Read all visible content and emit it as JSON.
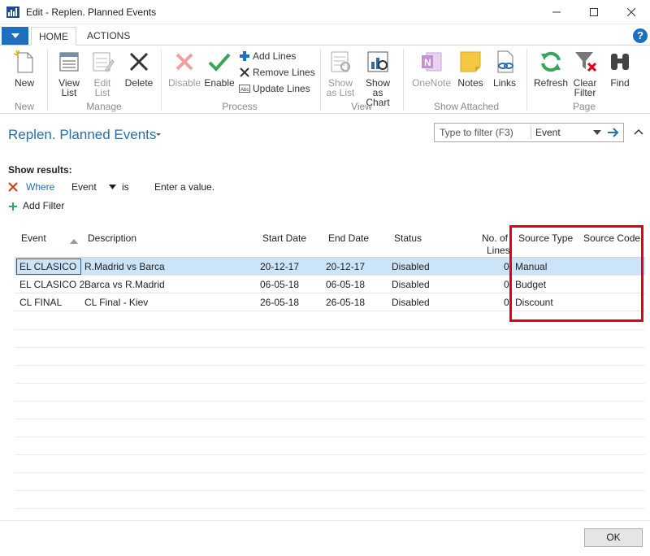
{
  "window": {
    "title": "Edit - Replen. Planned Events",
    "colors": {
      "accent": "#1f6fbf",
      "highlight_box": "#e0001a",
      "selected_row": "#cce4f7"
    }
  },
  "ribbon": {
    "tabs": [
      "HOME",
      "ACTIONS"
    ],
    "buttons": {
      "new": "New",
      "view_list": "View\nList",
      "edit_list": "Edit\nList",
      "delete": "Delete",
      "disable": "Disable",
      "enable": "Enable",
      "add_lines": "Add Lines",
      "remove_lines": "Remove Lines",
      "update_lines": "Update Lines",
      "show_as_list": "Show\nas List",
      "show_as_chart": "Show as\nChart",
      "onenote": "OneNote",
      "notes": "Notes",
      "links": "Links",
      "refresh": "Refresh",
      "clear_filter": "Clear\nFilter",
      "find": "Find"
    },
    "groups": {
      "new": "New",
      "manage": "Manage",
      "process": "Process",
      "view": "View",
      "show_attached": "Show Attached",
      "page": "Page"
    }
  },
  "page": {
    "title": "Replen. Planned Events",
    "filter": {
      "placeholder": "Type to filter (F3)",
      "field": "Event"
    },
    "show_results": "Show results:",
    "where": {
      "label": "Where",
      "field": "Event",
      "operator": "is",
      "value": "Enter a value."
    },
    "add_filter": "Add Filter"
  },
  "table": {
    "headers": {
      "event": "Event",
      "description": "Description",
      "start_date": "Start Date",
      "end_date": "End Date",
      "status": "Status",
      "no_of_lines_1": "No. of",
      "no_of_lines_2": "Lines",
      "source_type": "Source Type",
      "source_code": "Source Code"
    },
    "rows": [
      {
        "event": "EL CLASICO",
        "description": "R.Madrid vs Barca",
        "start_date": "20-12-17",
        "end_date": "20-12-17",
        "status": "Disabled",
        "lines": "0",
        "source_type": "Manual",
        "source_code": ""
      },
      {
        "event": "EL CLASICO 2",
        "description": "Barca vs R.Madrid",
        "start_date": "06-05-18",
        "end_date": "06-05-18",
        "status": "Disabled",
        "lines": "0",
        "source_type": "Budget",
        "source_code": ""
      },
      {
        "event": "CL FINAL",
        "description": "CL Final - Kiev",
        "start_date": "26-05-18",
        "end_date": "26-05-18",
        "status": "Disabled",
        "lines": "0",
        "source_type": "Discount",
        "source_code": ""
      }
    ]
  },
  "footer": {
    "ok": "OK"
  }
}
